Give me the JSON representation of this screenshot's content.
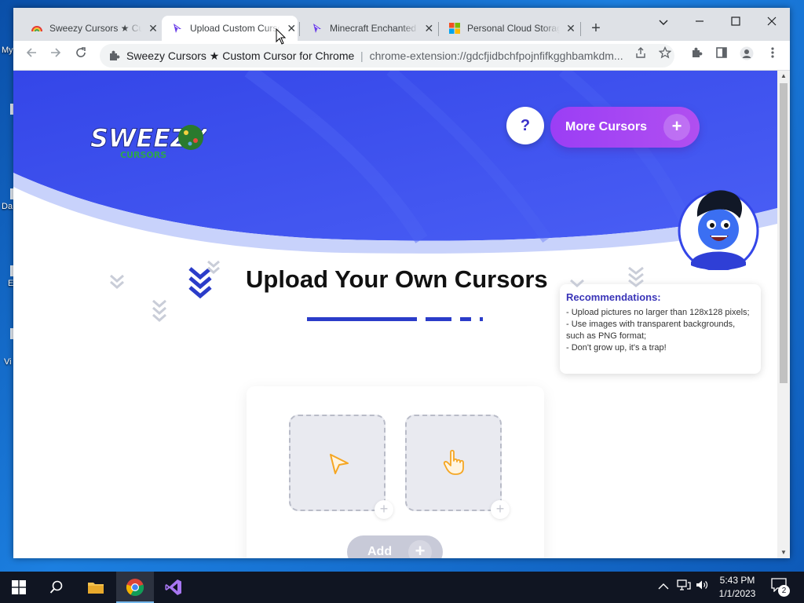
{
  "desktop": {
    "icon_labels": [
      "My",
      "Da",
      "E",
      "Vi"
    ]
  },
  "browser": {
    "tabs": [
      {
        "title": "Sweezy Cursors ★ Custom Cursor for Chrome",
        "icon": "sweezy-rainbow-icon",
        "active": false
      },
      {
        "title": "Upload Custom Cursors",
        "icon": "sweezy-logo-icon",
        "active": true
      },
      {
        "title": "Minecraft Enchanted Cursors",
        "icon": "sweezy-logo-icon",
        "active": false
      },
      {
        "title": "Personal Cloud Storage",
        "icon": "microsoft-icon",
        "active": false
      }
    ],
    "new_tab_label": "+",
    "close_glyph": "✕",
    "omnibox": {
      "site_name": "Sweezy Cursors ★ Custom Cursor for Chrome™",
      "separator": "|",
      "url": "chrome-extension://gdcfjidbchfpojnfifkgghbamkdm..."
    }
  },
  "page": {
    "logo_text": "SWEEZY",
    "logo_subtext": "CURSORS",
    "help_label": "?",
    "more_cursors_label": "More Cursors",
    "more_cursors_plus": "+",
    "heading": "Upload Your Own Cursors",
    "tip": {
      "title": "Recommendations:",
      "lines": [
        "- Upload pictures no larger than 128x128 pixels;",
        "- Use images with transparent backgrounds, such as PNG format;",
        "- Don't grow up, it's a trap!"
      ]
    },
    "upload_slots": [
      {
        "name": "pointer-cursor-slot",
        "icon": "arrow-cursor-icon"
      },
      {
        "name": "hand-cursor-slot",
        "icon": "hand-cursor-icon"
      }
    ],
    "slot_plus": "+",
    "add_label": "Add",
    "add_plus": "+"
  },
  "taskbar": {
    "time": "5:43 PM",
    "date": "1/1/2023",
    "notification_count": "2"
  },
  "colors": {
    "hero_blue": "#3a54f0",
    "accent_purple": "#9b3ef5",
    "chevron_blue": "#2b3cc9",
    "tip_title": "#3a35b8"
  }
}
